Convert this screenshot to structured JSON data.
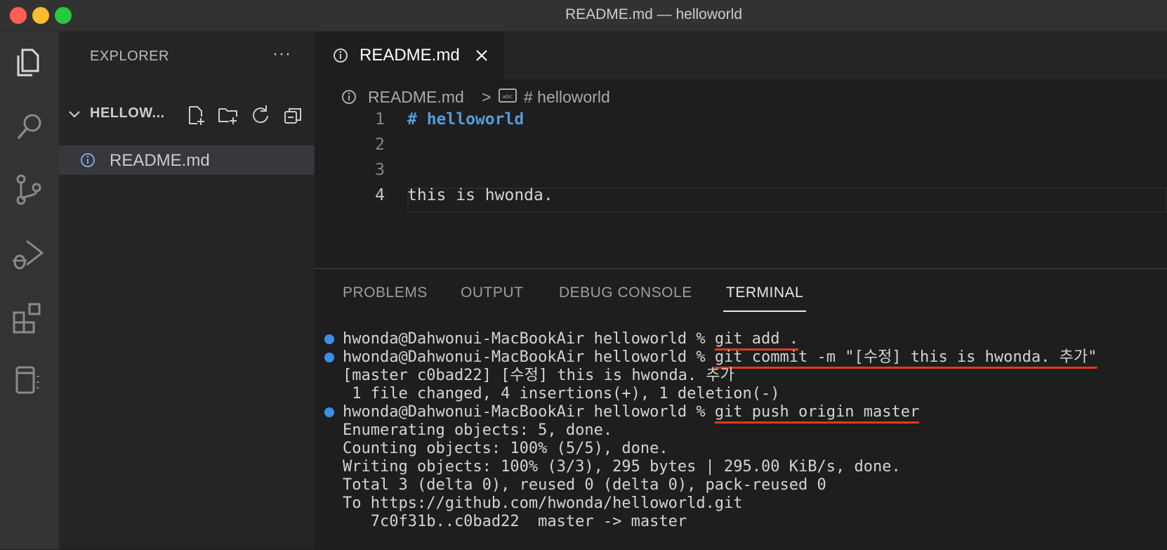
{
  "window": {
    "title": "README.md — helloworld"
  },
  "activity_bar": {
    "items": [
      "explorer-icon",
      "search-icon",
      "source-control-icon",
      "run-debug-icon",
      "extensions-icon",
      "notebook-icon"
    ]
  },
  "sidebar": {
    "title": "EXPLORER",
    "more": "···",
    "folder": {
      "name": "HELLOW..."
    },
    "files": [
      {
        "name": "README.md",
        "icon": "info-icon"
      }
    ]
  },
  "editor": {
    "tab": {
      "label": "README.md"
    },
    "breadcrumb": {
      "file": "README.md",
      "separator": ">",
      "symbol": "# helloworld"
    },
    "lines": [
      {
        "num": "1",
        "text": "# helloworld"
      },
      {
        "num": "2",
        "text": ""
      },
      {
        "num": "3",
        "text": ""
      },
      {
        "num": "4",
        "text": "this is hwonda."
      }
    ]
  },
  "panel": {
    "tabs": [
      "PROBLEMS",
      "OUTPUT",
      "DEBUG CONSOLE",
      "TERMINAL"
    ],
    "active_tab": "TERMINAL",
    "terminal": {
      "prompt": "hwonda@Dahwonui-MacBookAir helloworld % ",
      "cmd1": "git add .",
      "cmd2": "git commit -m \"[수정] this is hwonda. 추가\"",
      "out2a": "[master c0bad22] [수정] this is hwonda. 추가",
      "out2b": " 1 file changed, 4 insertions(+), 1 deletion(-)",
      "cmd3": "git push origin master",
      "out3": [
        "Enumerating objects: 5, done.",
        "Counting objects: 100% (5/5), done.",
        "Writing objects: 100% (3/3), 295 bytes | 295.00 KiB/s, done.",
        "Total 3 (delta 0), reused 0 (delta 0), pack-reused 0",
        "To https://github.com/hwonda/helloworld.git",
        "   7c0f31b..c0bad22  master -> master"
      ]
    }
  },
  "colors": {
    "accent": "#3b8eea",
    "annotation": "#e5391c",
    "heading": "#569cd6"
  }
}
